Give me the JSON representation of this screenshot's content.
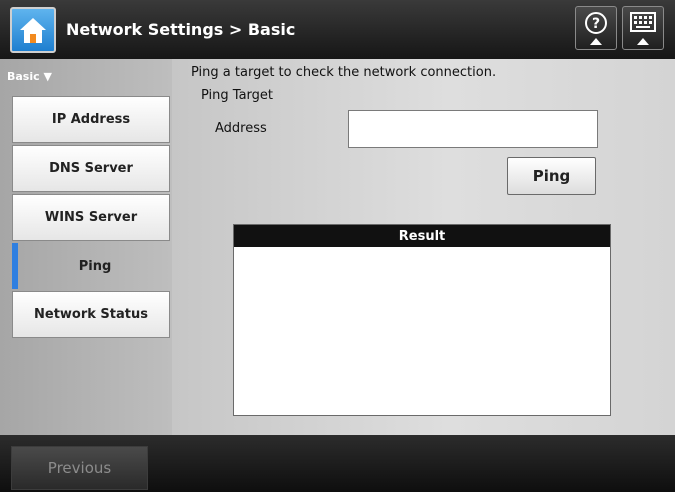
{
  "header": {
    "title": "Network Settings > Basic",
    "home_icon": "home-icon",
    "help_icon": "help-icon",
    "keyboard_icon": "keyboard-icon"
  },
  "sidebar": {
    "heading": "Basic ▼",
    "items": [
      {
        "label": "IP Address"
      },
      {
        "label": "DNS Server"
      },
      {
        "label": "WINS Server"
      },
      {
        "label": "Ping"
      },
      {
        "label": "Network Status"
      }
    ],
    "active_item": "Ping",
    "active_color": "#2f7fe0"
  },
  "main": {
    "description": "Ping a target to check the network connection.",
    "section_label": "Ping Target",
    "address_label": "Address",
    "address_value": "",
    "ping_button": "Ping",
    "result_header": "Result",
    "result_text": ""
  },
  "footer": {
    "previous_button": "Previous"
  }
}
